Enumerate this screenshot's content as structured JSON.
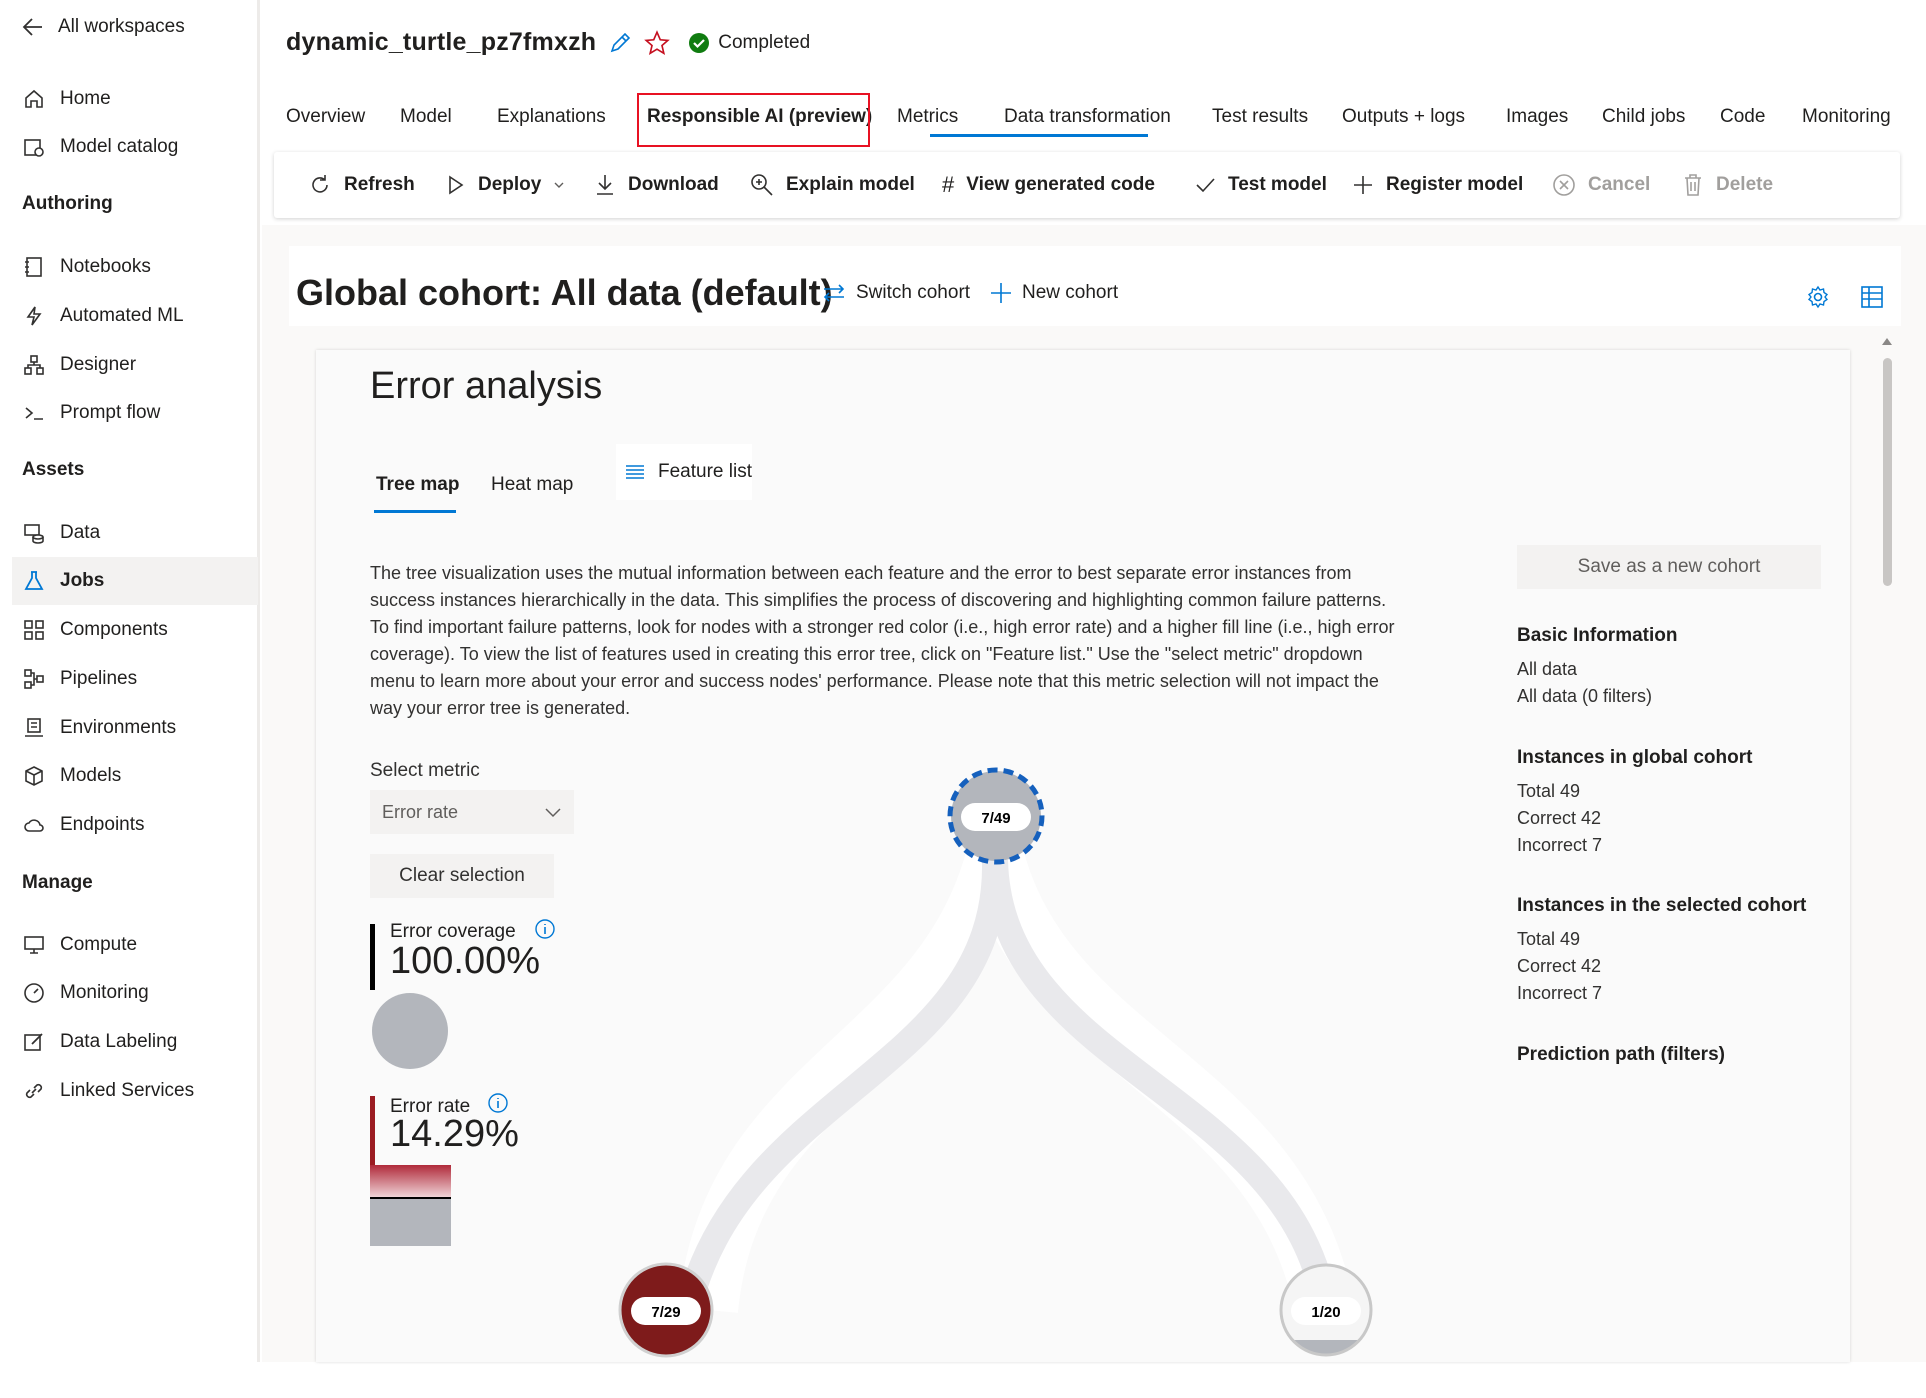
{
  "sidebar": {
    "back_label": "All workspaces",
    "home": "Home",
    "model_catalog": "Model catalog",
    "section_authoring": "Authoring",
    "notebooks": "Notebooks",
    "automated_ml": "Automated ML",
    "designer": "Designer",
    "prompt_flow": "Prompt flow",
    "section_assets": "Assets",
    "data": "Data",
    "jobs": "Jobs",
    "components": "Components",
    "pipelines": "Pipelines",
    "environments": "Environments",
    "models": "Models",
    "endpoints": "Endpoints",
    "section_manage": "Manage",
    "compute": "Compute",
    "monitoring": "Monitoring",
    "data_labeling": "Data Labeling",
    "linked_services": "Linked Services"
  },
  "header": {
    "job_name": "dynamic_turtle_pz7fmxzh",
    "status": "Completed",
    "status_color": "#107c10"
  },
  "tabs": [
    "Overview",
    "Model",
    "Explanations",
    "Responsible AI (preview)",
    "Metrics",
    "Data transformation",
    "Test results",
    "Outputs + logs",
    "Images",
    "Child jobs",
    "Code",
    "Monitoring"
  ],
  "toolbar": {
    "refresh": "Refresh",
    "deploy": "Deploy",
    "download": "Download",
    "explain_model": "Explain model",
    "view_generated_code": "View generated code",
    "test_model": "Test model",
    "register_model": "Register model",
    "cancel": "Cancel",
    "delete": "Delete"
  },
  "cohort": {
    "title": "Global cohort: All data (default)",
    "switch": "Switch cohort",
    "new": "New cohort"
  },
  "error_analysis": {
    "title": "Error analysis",
    "tab_tree_map": "Tree map",
    "tab_heat_map": "Heat map",
    "feature_list": "Feature list",
    "description": "The tree visualization uses the mutual information between each feature and the error to best separate error instances from success instances hierarchically in the data. This simplifies the process of discovering and highlighting common failure patterns. To find important failure patterns, look for nodes with a stronger red color (i.e., high error rate) and a higher fill line (i.e., high error coverage). To view the list of features used in creating this error tree, click on \"Feature list.\" Use the \"select metric\" dropdown menu to learn more about your error and success nodes' performance. Please note that this metric selection will not impact the way your error tree is generated.",
    "select_metric_label": "Select metric",
    "select_metric_value": "Error rate",
    "clear_selection": "Clear selection",
    "error_coverage_label": "Error coverage",
    "error_coverage_value": "100.00%",
    "error_rate_label": "Error rate",
    "error_rate_value": "14.29%",
    "tree": {
      "root": "7/49",
      "left": "7/29",
      "right": "1/20"
    }
  },
  "side_panel": {
    "save_button": "Save as a new cohort",
    "basic_info_head": "Basic Information",
    "basic_info_1": "All data",
    "basic_info_2": "All data (0 filters)",
    "global_head": "Instances in global cohort",
    "global_total": "Total 49",
    "global_correct": "Correct 42",
    "global_incorrect": "Incorrect 7",
    "selected_head": "Instances in the selected cohort",
    "selected_total": "Total 49",
    "selected_correct": "Correct 42",
    "selected_incorrect": "Incorrect 7",
    "prediction_path_head": "Prediction path (filters)"
  }
}
